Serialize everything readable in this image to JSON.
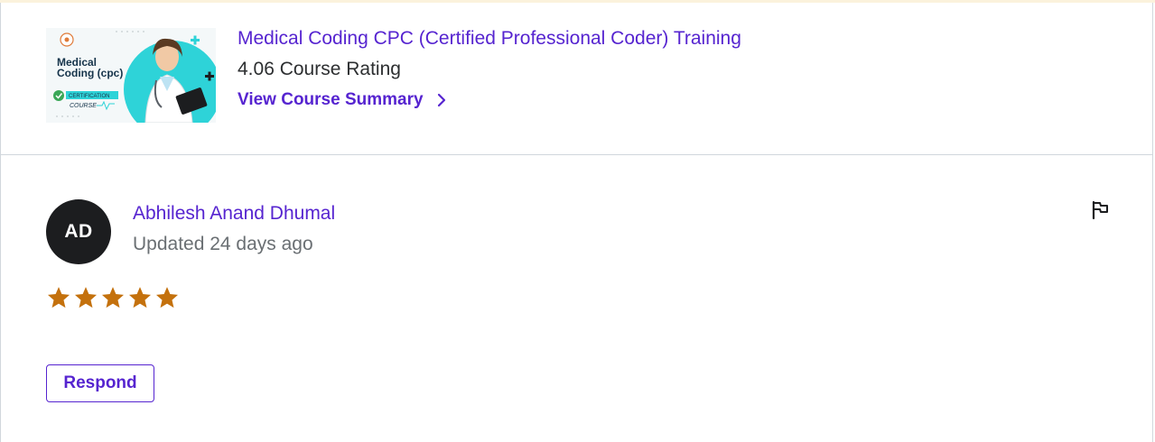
{
  "course": {
    "title": "Medical Coding CPC (Certified Professional Coder) Training",
    "rating_text": "4.06 Course Rating",
    "summary_link": "View Course Summary",
    "thumbnail": {
      "title_line1": "Medical",
      "title_line2": "Coding (cpc)",
      "badge_line1": "CERTIFICATION",
      "badge_line2": "COURSE"
    }
  },
  "review": {
    "avatar_initials": "AD",
    "reviewer_name": "Abhilesh Anand Dhumal",
    "updated": "Updated 24 days ago",
    "stars": 5,
    "respond_label": "Respond"
  },
  "colors": {
    "accent": "#5624d0",
    "star": "#c4710d",
    "avatar_bg": "#1c1d1f",
    "thumb_teal": "#2ed3d8"
  },
  "icons": {
    "summary": "chevron-right-icon",
    "report": "flag-icon",
    "rating": "star-icon"
  }
}
